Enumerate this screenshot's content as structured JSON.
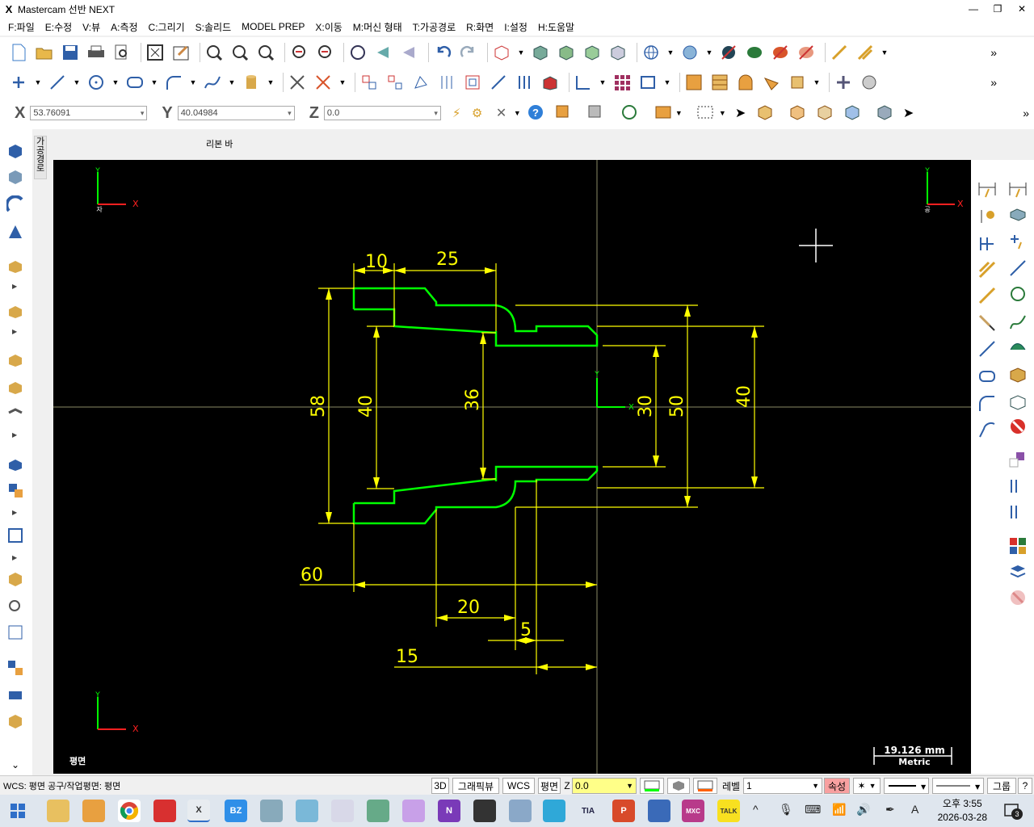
{
  "window": {
    "logo": "X",
    "title": "Mastercam 선반 NEXT",
    "minimize": "—",
    "restore": "❐",
    "close": "✕"
  },
  "menu": [
    "F:파일",
    "E:수정",
    "V:뷰",
    "A:측정",
    "C:그리기",
    "S:솔리드",
    "MODEL PREP",
    "X:이동",
    "M:머신 형태",
    "T:가공경로",
    "R:화면",
    "I:설정",
    "H:도움말"
  ],
  "toolbar_more": "»",
  "coords": {
    "x_label": "X",
    "x_value": "53.76091",
    "y_label": "Y",
    "y_value": "40.04984",
    "z_label": "Z",
    "z_value": "0.0"
  },
  "ribbon": {
    "label": "리본 바",
    "vertical_tab": "가공경로"
  },
  "viewport": {
    "background": "#000000",
    "part_color": "#00ff00",
    "dim_color": "#ffff00",
    "axis_label_x": "X",
    "axis_label_y": "Y",
    "corner_label_tl": "자",
    "corner_label_tr": "공",
    "view_name": "평면",
    "dimensions": [
      "10",
      "25",
      "58",
      "40",
      "36",
      "30",
      "50",
      "40",
      "60",
      "20",
      "5",
      "15"
    ],
    "scale_value": "19.126 mm",
    "scale_unit": "Metric"
  },
  "status": {
    "text": "WCS: 평면  공구/작업평면: 평면",
    "btn_3d": "3D",
    "btn_graphicview": "그래픽뷰",
    "btn_wcs": "WCS",
    "btn_plane": "평면",
    "z_label": "Z",
    "z_value": "0.0",
    "level_label": "레벨",
    "level_value": "1",
    "attr_label": "속성",
    "group_label": "그룹",
    "help": "?"
  },
  "taskbar": {
    "time": "오후 3:55",
    "date": "2026-03-28",
    "ime": "A",
    "notify_count": "3"
  }
}
